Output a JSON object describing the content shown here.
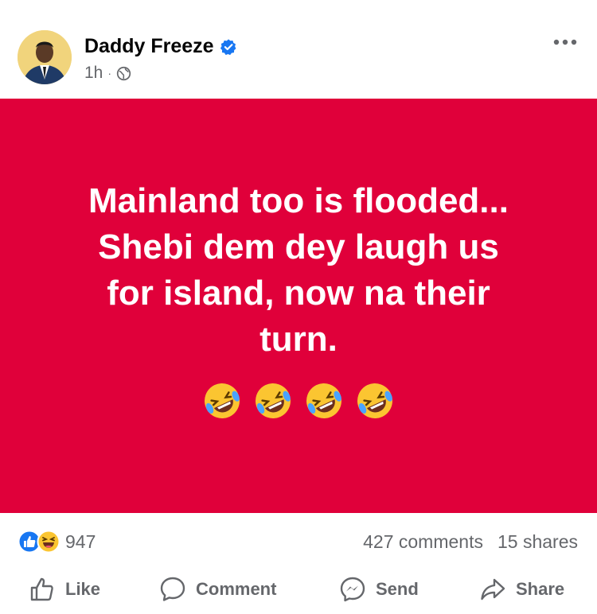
{
  "post": {
    "author": "Daddy Freeze",
    "time": "1h",
    "separator": "·",
    "text_lines": [
      "Mainland too is flooded...",
      "Shebi dem dey laugh us",
      "for island, now na their",
      "turn."
    ],
    "emojis": [
      "rolling-on-floor-laughing",
      "rolling-on-floor-laughing",
      "rolling-on-floor-laughing",
      "rolling-on-floor-laughing"
    ],
    "background_color": "#e0003a"
  },
  "stats": {
    "reaction_count": "947",
    "comments": "427 comments",
    "shares": "15 shares"
  },
  "actions": {
    "like": "Like",
    "comment": "Comment",
    "send": "Send",
    "share": "Share"
  },
  "icons": {
    "verified": "verified-badge-icon",
    "audience": "globe-icon",
    "more": "more-options-icon",
    "like": "thumbs-up-icon",
    "comment": "comment-bubble-icon",
    "send": "messenger-icon",
    "share": "share-arrow-icon"
  },
  "colors": {
    "post_background": "#e0003a",
    "like_blue": "#1877f2",
    "muted": "#65676b"
  }
}
